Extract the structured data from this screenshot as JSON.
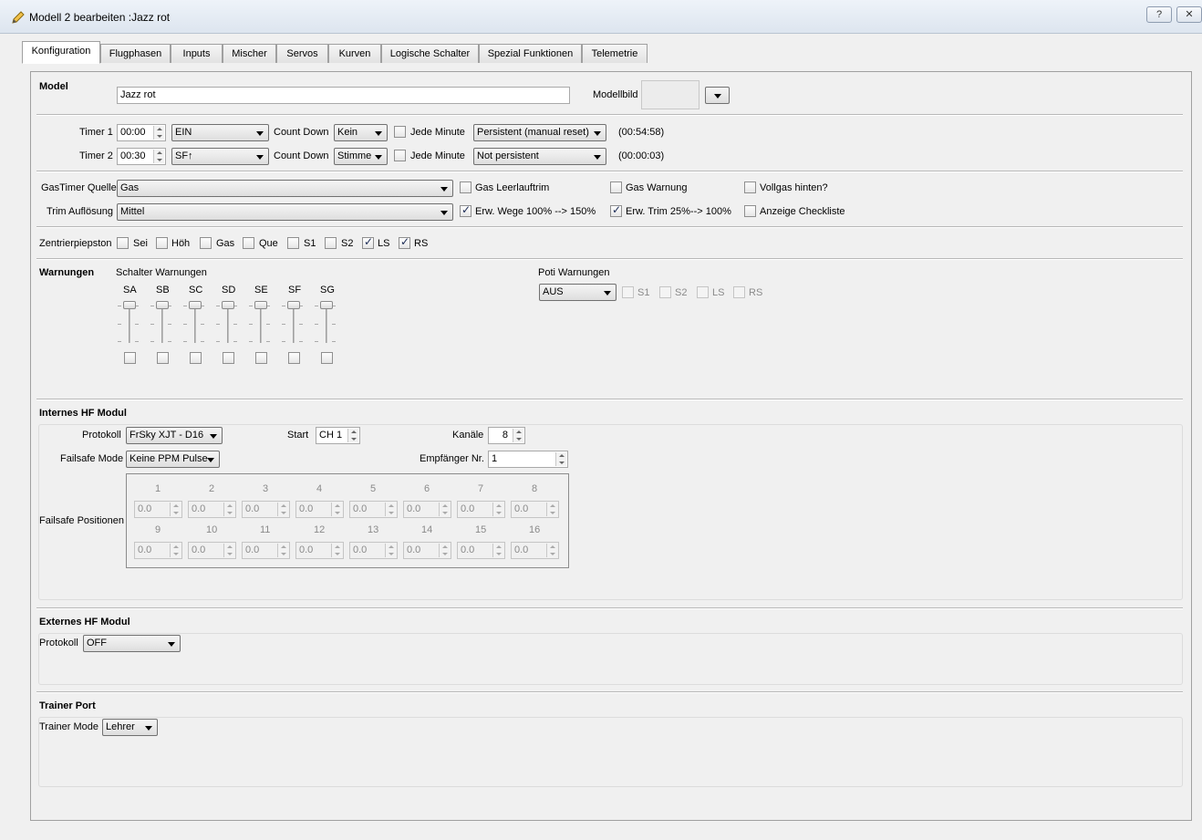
{
  "window": {
    "title": "Modell 2 bearbeiten :Jazz rot",
    "help_label": "?",
    "close_label": "✕"
  },
  "tabs": [
    "Konfiguration",
    "Flugphasen",
    "Inputs",
    "Mischer",
    "Servos",
    "Kurven",
    "Logische Schalter",
    "Spezial Funktionen",
    "Telemetrie"
  ],
  "model": {
    "label": "Model",
    "name": "Jazz rot",
    "image_label": "Modellbild"
  },
  "timer1": {
    "label": "Timer 1",
    "value": "00:00",
    "mode": "EIN",
    "countdown_label": "Count Down",
    "countdown": "Kein",
    "minute_label": "Jede Minute",
    "persist": "Persistent (manual reset)",
    "elapsed": "(00:54:58)"
  },
  "timer2": {
    "label": "Timer 2",
    "value": "00:30",
    "mode": "SF↑",
    "countdown_label": "Count Down",
    "countdown": "Stimme",
    "minute_label": "Jede Minute",
    "persist": "Not persistent",
    "elapsed": "(00:00:03)"
  },
  "throttle": {
    "source_label": "GasTimer Quelle",
    "source": "Gas",
    "trim_label": "Trim Auflösung",
    "trim": "Mittel",
    "options": [
      {
        "label": "Gas Leerlauftrim",
        "checked": false
      },
      {
        "label": "Gas Warnung",
        "checked": false
      },
      {
        "label": "Vollgas hinten?",
        "checked": false
      },
      {
        "label": "Erw. Wege 100% --> 150%",
        "checked": true
      },
      {
        "label": "Erw. Trim 25%--> 100%",
        "checked": true
      },
      {
        "label": "Anzeige Checkliste",
        "checked": false
      }
    ]
  },
  "center_beep": {
    "label": "Zentrierpiepston",
    "items": [
      {
        "label": "Sei",
        "checked": false
      },
      {
        "label": "Höh",
        "checked": false
      },
      {
        "label": "Gas",
        "checked": false
      },
      {
        "label": "Que",
        "checked": false
      },
      {
        "label": "S1",
        "checked": false
      },
      {
        "label": "S2",
        "checked": false
      },
      {
        "label": "LS",
        "checked": true
      },
      {
        "label": "RS",
        "checked": true
      }
    ]
  },
  "warnings": {
    "label": "Warnungen",
    "switch_label": "Schalter Warnungen",
    "switches": [
      "SA",
      "SB",
      "SC",
      "SD",
      "SE",
      "SF",
      "SG"
    ],
    "pot_label": "Poti Warnungen",
    "pot_mode": "AUS",
    "pots": [
      "S1",
      "S2",
      "LS",
      "RS"
    ]
  },
  "internal_rf": {
    "label": "Internes HF Modul",
    "protocol_label": "Protokoll",
    "protocol": "FrSky XJT - D16",
    "start_label": "Start",
    "start": "CH 1",
    "channels_label": "Kanäle",
    "channels": "8",
    "failsafe_label": "Failsafe Mode",
    "failsafe": "Keine PPM Pulse",
    "receiver_label": "Empfänger Nr.",
    "receiver": "1",
    "positions_label": "Failsafe Positionen",
    "positions": [
      {
        "ch": "1",
        "value": "0.0"
      },
      {
        "ch": "2",
        "value": "0.0"
      },
      {
        "ch": "3",
        "value": "0.0"
      },
      {
        "ch": "4",
        "value": "0.0"
      },
      {
        "ch": "5",
        "value": "0.0"
      },
      {
        "ch": "6",
        "value": "0.0"
      },
      {
        "ch": "7",
        "value": "0.0"
      },
      {
        "ch": "8",
        "value": "0.0"
      },
      {
        "ch": "9",
        "value": "0.0"
      },
      {
        "ch": "10",
        "value": "0.0"
      },
      {
        "ch": "11",
        "value": "0.0"
      },
      {
        "ch": "12",
        "value": "0.0"
      },
      {
        "ch": "13",
        "value": "0.0"
      },
      {
        "ch": "14",
        "value": "0.0"
      },
      {
        "ch": "15",
        "value": "0.0"
      },
      {
        "ch": "16",
        "value": "0.0"
      }
    ]
  },
  "external_rf": {
    "label": "Externes HF Modul",
    "protocol_label": "Protokoll",
    "protocol": "OFF"
  },
  "trainer": {
    "label": "Trainer Port",
    "mode_label": "Trainer Mode",
    "mode": "Lehrer"
  }
}
